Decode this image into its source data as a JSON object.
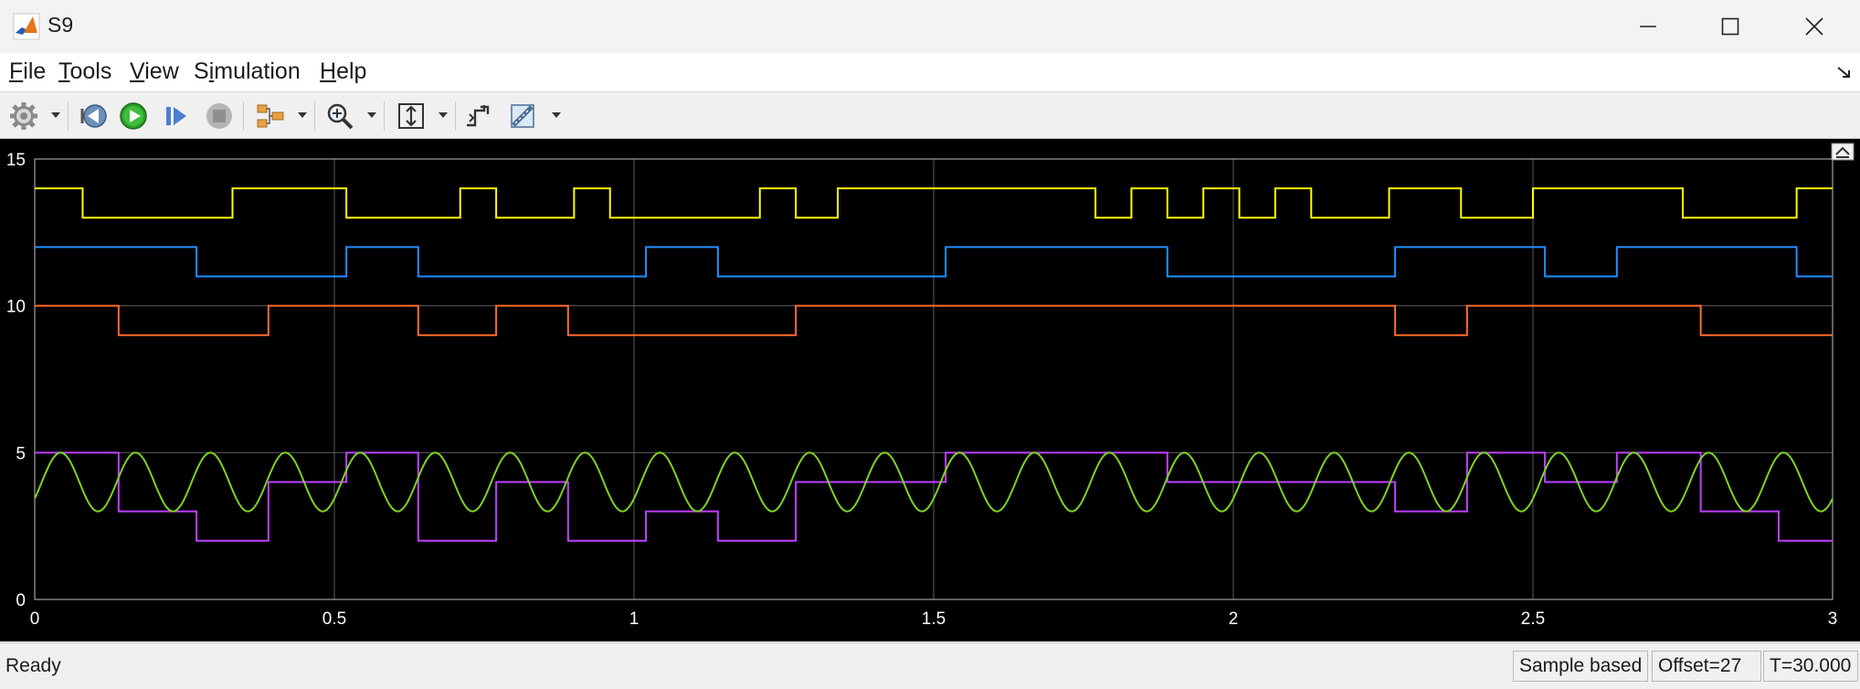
{
  "window": {
    "title": "S9",
    "minimize_icon": "minimize-icon",
    "maximize_icon": "maximize-icon",
    "close_icon": "close-icon"
  },
  "menu": [
    {
      "label": "File",
      "accel": "F"
    },
    {
      "label": "Tools",
      "accel": "T"
    },
    {
      "label": "View",
      "accel": "V"
    },
    {
      "label": "Simulation",
      "accel": "i"
    },
    {
      "label": "Help",
      "accel": "H"
    }
  ],
  "toolbar": {
    "icons": [
      "settings-gear-icon",
      "step-back-icon",
      "run-icon",
      "step-forward-icon",
      "stop-icon",
      "signal-selector-icon",
      "zoom-icon",
      "autoscale-icon",
      "triggers-icon",
      "measurements-icon"
    ]
  },
  "status": {
    "ready": "Ready",
    "sample_mode": "Sample based",
    "offset": "Offset=27",
    "time": "T=30.000"
  },
  "colors": {
    "background": "#000000",
    "grid": "#5a5a5a",
    "axis": "#ffffff"
  },
  "chart_data": {
    "type": "line",
    "xlim": [
      0,
      3
    ],
    "ylim": [
      0,
      15
    ],
    "x_ticks": [
      "0",
      "0.5",
      "1",
      "1.5",
      "2",
      "2.5",
      "3"
    ],
    "y_ticks": [
      "0",
      "5",
      "10",
      "15"
    ],
    "grid": true,
    "series": [
      {
        "color": "#ffff00",
        "step": true,
        "x": [
          0,
          0.08,
          0.33,
          0.52,
          0.71,
          0.77,
          0.9,
          0.96,
          1.21,
          1.27,
          1.34,
          1.77,
          1.83,
          1.89,
          1.95,
          2.01,
          2.07,
          2.13,
          2.26,
          2.38,
          2.5,
          2.75,
          2.94,
          3
        ],
        "y": [
          14,
          13,
          14,
          13,
          14,
          13,
          14,
          13,
          14,
          13,
          14,
          13,
          14,
          13,
          14,
          13,
          14,
          13,
          14,
          13,
          14,
          13,
          14,
          14
        ]
      },
      {
        "color": "#1e90ff",
        "step": true,
        "x": [
          0,
          0.27,
          0.52,
          0.64,
          1.02,
          1.14,
          1.52,
          1.89,
          2.27,
          2.52,
          2.64,
          2.94,
          3
        ],
        "y": [
          12,
          11,
          12,
          11,
          12,
          11,
          12,
          11,
          12,
          11,
          12,
          11,
          11
        ]
      },
      {
        "color": "#ff6a2a",
        "step": true,
        "x": [
          0,
          0.14,
          0.39,
          0.64,
          0.77,
          0.89,
          1.27,
          2.27,
          2.39,
          2.78,
          3
        ],
        "y": [
          10,
          9,
          10,
          9,
          10,
          9,
          10,
          9,
          10,
          9,
          9
        ]
      },
      {
        "color": "#c040ff",
        "step": true,
        "x": [
          0,
          0.14,
          0.27,
          0.39,
          0.52,
          0.64,
          0.77,
          0.89,
          1.02,
          1.14,
          1.27,
          1.52,
          1.89,
          2.27,
          2.39,
          2.52,
          2.64,
          2.78,
          2.91,
          3
        ],
        "y": [
          5,
          3,
          2,
          4,
          5,
          2,
          4,
          2,
          3,
          2,
          4,
          5,
          4,
          3,
          5,
          4,
          5,
          3,
          2,
          2
        ]
      },
      {
        "color": "#7ed321",
        "sine": true,
        "offset": 4,
        "amplitude": 1,
        "period": 0.125,
        "x_start": 0,
        "x_end": 3
      }
    ]
  }
}
